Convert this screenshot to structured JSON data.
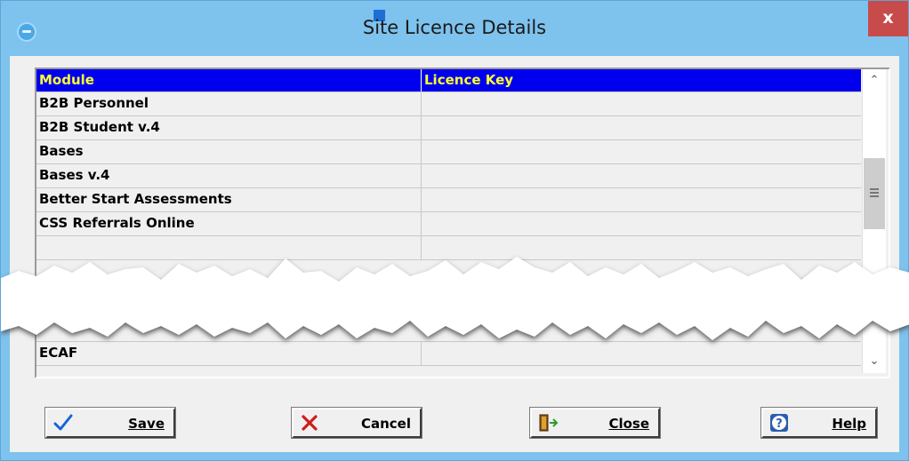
{
  "window": {
    "title": "Site Licence Details",
    "close_label": "x"
  },
  "grid": {
    "columns": [
      "Module",
      "Licence Key"
    ],
    "rows": [
      {
        "module": "B2B Personnel",
        "licence_key": ""
      },
      {
        "module": "B2B Student v.4",
        "licence_key": ""
      },
      {
        "module": "Bases",
        "licence_key": ""
      },
      {
        "module": "Bases v.4",
        "licence_key": ""
      },
      {
        "module": "Better Start Assessments",
        "licence_key": ""
      },
      {
        "module": "CSS Referrals Online",
        "licence_key": ""
      }
    ],
    "last_row": {
      "module": "ECAF",
      "licence_key": ""
    }
  },
  "buttons": {
    "save": "Save",
    "cancel": "Cancel",
    "close": "Close",
    "help": "Help"
  },
  "icons": {
    "app": "app-icon",
    "save": "checkmark-icon",
    "cancel": "x-mark-icon",
    "close": "door-exit-icon",
    "help": "question-mark-icon"
  },
  "colors": {
    "header_bg": "#0000ee",
    "header_text": "#ffff33",
    "window_border": "#7ec2ee",
    "close_button": "#c74b4b"
  }
}
